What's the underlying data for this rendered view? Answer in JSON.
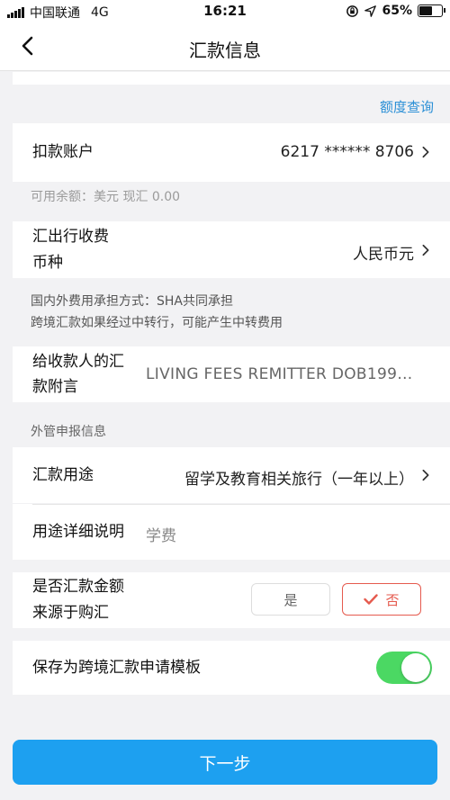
{
  "status_bar": {
    "carrier": "中国联通",
    "network": "4G",
    "time": "16:21",
    "battery": "65%",
    "battery_level": 0.65
  },
  "nav": {
    "title": "汇款信息"
  },
  "quota_link": "额度查询",
  "debit_account": {
    "label": "扣款账户",
    "value": "6217 ****** 8706"
  },
  "available_balance": "可用余额：美元 现汇 0.00",
  "fee_currency": {
    "label_line1": "汇出行收费",
    "label_line2": "币种",
    "value": "人民币元"
  },
  "fee_notes": {
    "line1": "国内外费用承担方式：SHA共同承担",
    "line2": "跨境汇款如果经过中转行，可能产生中转费用"
  },
  "remittance_message": {
    "label_line1": "给收款人的汇",
    "label_line2": "款附言",
    "value": "LIVING FEES REMITTER DOB199…"
  },
  "fx_section_title": "外管申报信息",
  "purpose": {
    "label": "汇款用途",
    "value": "留学及教育相关旅行（一年以上）"
  },
  "purpose_detail": {
    "label": "用途详细说明",
    "value": "学费"
  },
  "purchase_source": {
    "label_line1": "是否汇款金额",
    "label_line2": "来源于购汇",
    "yes": "是",
    "no": "否",
    "selected": "否"
  },
  "save_template": {
    "label": "保存为跨境汇款申请模板",
    "enabled": true
  },
  "next_button": "下一步",
  "colors": {
    "accent": "#1da0f0",
    "link": "#2a8fd6",
    "toggle_on": "#4bd863",
    "selected_red": "#e55a4e"
  }
}
